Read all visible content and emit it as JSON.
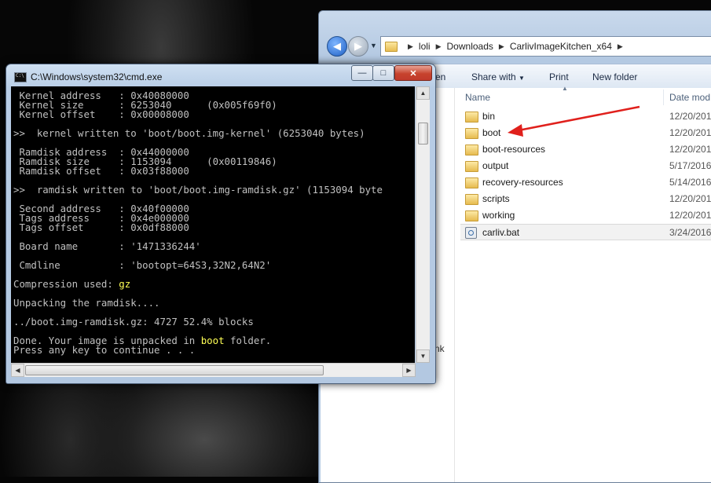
{
  "explorer": {
    "breadcrumbs": [
      "loli",
      "Downloads",
      "CarlivImageKitchen_x64"
    ],
    "toolbar": {
      "cut_label": "en",
      "share_label": "Share with",
      "print_label": "Print",
      "new_folder_label": "New folder"
    },
    "nav_pane_partial": "nk",
    "nav_pane_network": "Network",
    "columns": {
      "name": "Name",
      "date": "Date mod"
    },
    "files": [
      {
        "name": "bin",
        "date": "12/20/201",
        "type": "folder"
      },
      {
        "name": "boot",
        "date": "12/20/201",
        "type": "folder"
      },
      {
        "name": "boot-resources",
        "date": "12/20/201",
        "type": "folder"
      },
      {
        "name": "output",
        "date": "5/17/2016",
        "type": "folder"
      },
      {
        "name": "recovery-resources",
        "date": "5/14/2016",
        "type": "folder"
      },
      {
        "name": "scripts",
        "date": "12/20/201",
        "type": "folder"
      },
      {
        "name": "working",
        "date": "12/20/201",
        "type": "folder"
      },
      {
        "name": "carliv.bat",
        "date": "3/24/2016",
        "type": "bat"
      }
    ],
    "annotation_color": "#e0201c"
  },
  "cmd": {
    "title": "C:\\Windows\\system32\\cmd.exe",
    "lines": [
      {
        "text": " Kernel address   : 0x40080000"
      },
      {
        "text": " Kernel size      : 6253040      (0x005f69f0)"
      },
      {
        "text": " Kernel offset    : 0x00008000"
      },
      {
        "text": ""
      },
      {
        "text": ">>  kernel written to 'boot/boot.img-kernel' (6253040 bytes)"
      },
      {
        "text": ""
      },
      {
        "text": " Ramdisk address  : 0x44000000"
      },
      {
        "text": " Ramdisk size     : 1153094      (0x00119846)"
      },
      {
        "text": " Ramdisk offset   : 0x03f88000"
      },
      {
        "text": ""
      },
      {
        "text": ">>  ramdisk written to 'boot/boot.img-ramdisk.gz' (1153094 byte"
      },
      {
        "text": ""
      },
      {
        "text": " Second address   : 0x40f00000"
      },
      {
        "text": " Tags address     : 0x4e000000"
      },
      {
        "text": " Tags offset      : 0x0df88000"
      },
      {
        "text": ""
      },
      {
        "text": " Board name       : '1471336244'"
      },
      {
        "text": ""
      },
      {
        "text": " Cmdline          : 'bootopt=64S3,32N2,64N2'"
      },
      {
        "text": ""
      },
      {
        "text": "Compression used: ",
        "highlight": "gz"
      },
      {
        "text": ""
      },
      {
        "text": "Unpacking the ramdisk...."
      },
      {
        "text": ""
      },
      {
        "text": "../boot.img-ramdisk.gz: 4727 52.4% blocks"
      },
      {
        "text": ""
      },
      {
        "text": "Done. Your image is unpacked in ",
        "highlight": "boot",
        "suffix": " folder."
      },
      {
        "text": "Press any key to continue . . ."
      }
    ]
  }
}
